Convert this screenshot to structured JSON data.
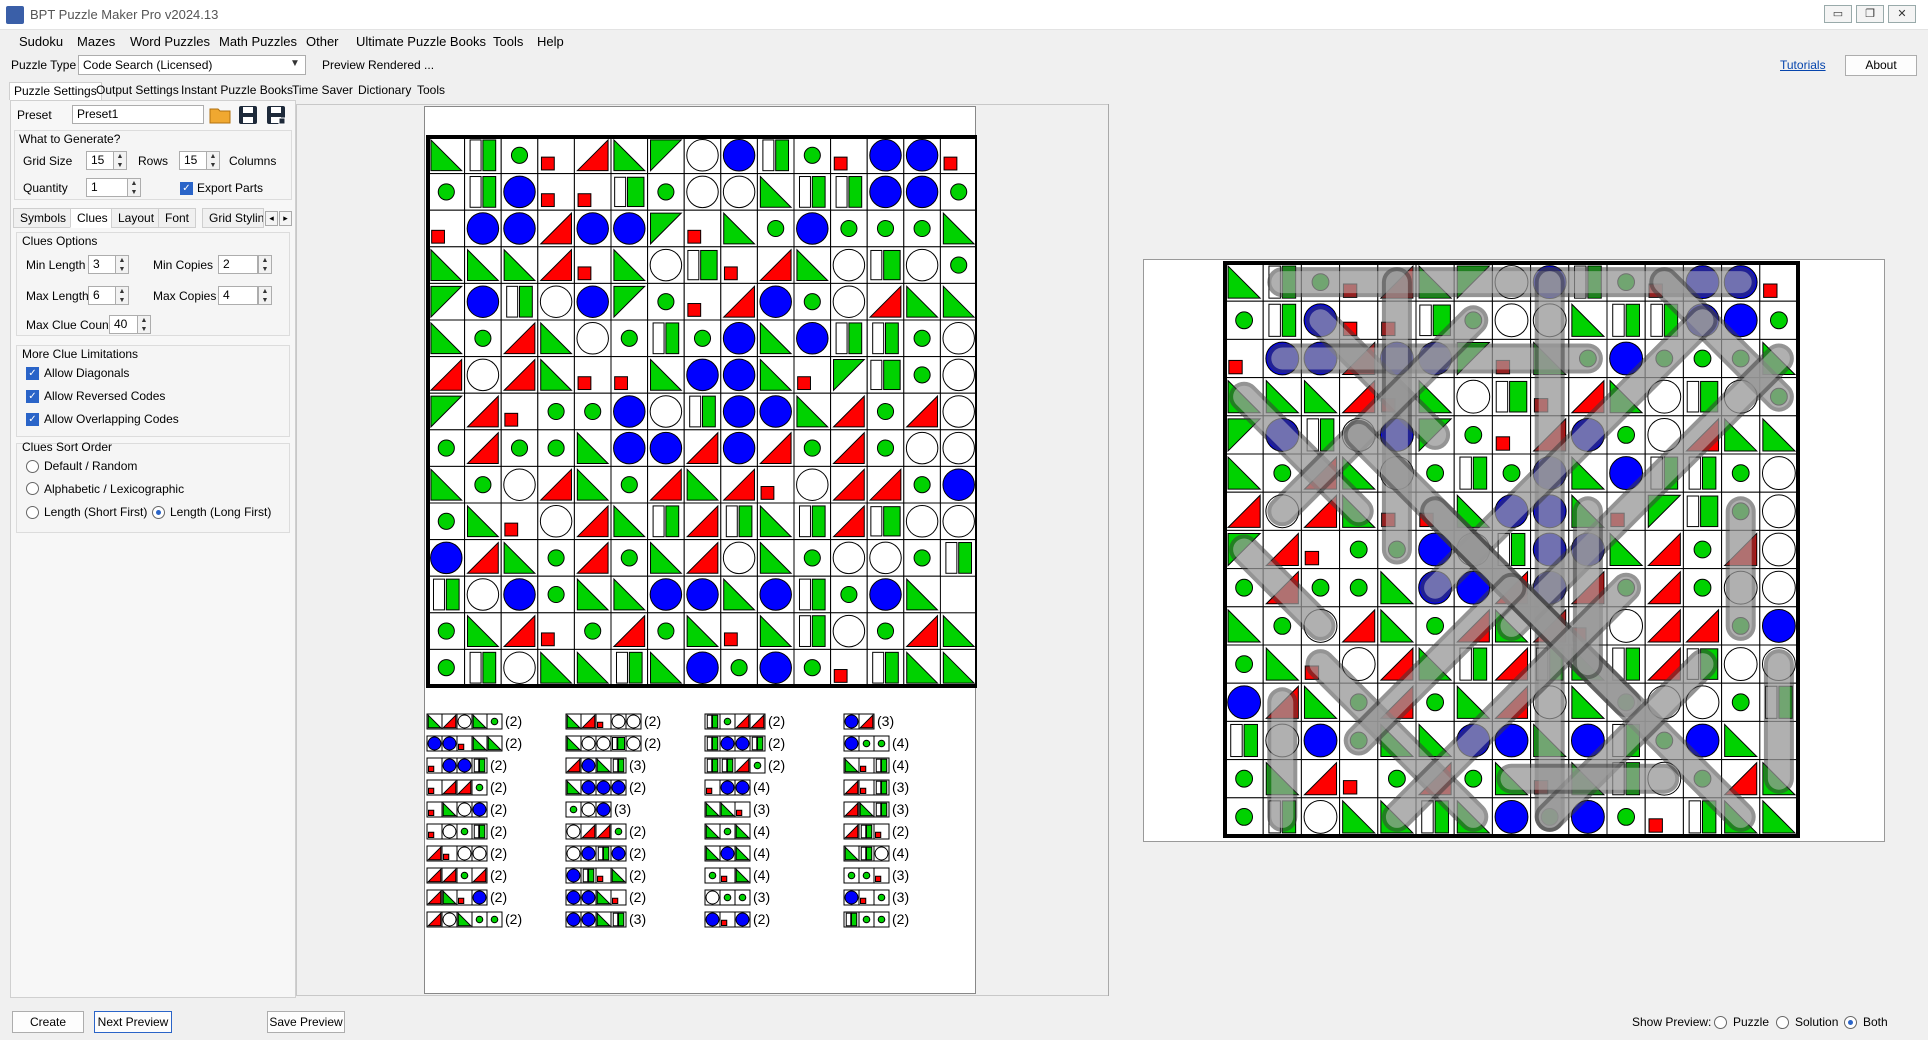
{
  "window": {
    "title": "BPT Puzzle Maker Pro v2024.13",
    "minimize": "▭",
    "restore": "❐",
    "close": "✕"
  },
  "menu": [
    "Sudoku",
    "Mazes",
    "Word Puzzles",
    "Math Puzzles",
    "Other",
    "Ultimate Puzzle Books",
    "Tools",
    "Help"
  ],
  "toprow": {
    "puzzle_type_label": "Puzzle Type",
    "puzzle_type_value": "Code Search (Licensed)",
    "preview_status": "Preview Rendered ...",
    "tutorials": "Tutorials",
    "about": "About"
  },
  "tabs": [
    "Puzzle Settings",
    "Output Settings",
    "Instant Puzzle Books",
    "Time Saver",
    "Dictionary",
    "Tools"
  ],
  "settings": {
    "preset_label": "Preset",
    "preset_value": "Preset1",
    "what_label": "What to Generate?",
    "grid_size_label": "Grid Size",
    "rows_value": "15",
    "rows_label": "Rows",
    "cols_value": "15",
    "cols_label": "Columns",
    "quantity_label": "Quantity",
    "quantity_value": "1",
    "export_parts_label": "Export Parts"
  },
  "subtabs": [
    "Symbols",
    "Clues",
    "Layout",
    "Font",
    "Grid Styling"
  ],
  "clues_options": {
    "title": "Clues Options",
    "min_length_label": "Min Length",
    "min_length": "3",
    "min_copies_label": "Min Copies",
    "min_copies": "2",
    "max_length_label": "Max Length",
    "max_length": "6",
    "max_copies_label": "Max Copies",
    "max_copies": "4",
    "max_clue_count_label": "Max Clue Count",
    "max_clue_count": "40"
  },
  "limitations": {
    "title": "More Clue Limitations",
    "items": [
      "Allow Diagonals",
      "Allow Reversed Codes",
      "Allow Overlapping Codes"
    ]
  },
  "sort_order": {
    "title": "Clues Sort Order",
    "items": [
      "Default / Random",
      "Alphabetic / Lexicographic",
      "Length (Short First)",
      "Length (Long First)"
    ]
  },
  "bottom": {
    "create": "Create",
    "next_preview": "Next Preview",
    "save_preview": "Save Preview",
    "show_preview_label": "Show Preview:",
    "options": [
      "Puzzle",
      "Solution",
      "Both"
    ]
  },
  "colors": {
    "green": "#00d200",
    "red": "#ff0000",
    "blue": "#0000ff",
    "accent": "#2a64c8"
  },
  "grid": [
    "TBdsRTVoOBdsOOs",
    "dBOsswdooTBBOOd",
    "sOOROOVsTdOdddT",
    "TTTRsTowsRTowod",
    "VOBoOVdsROdoRTT",
    "TdRTodBdOTOBBdo",
    "RoRTssTOOTsVwdo",
    "VRsddOoBOOTRdRo",
    "dRddTOORORdRdoo",
    "TdoRTdRTRsoRRdO",
    "dTsoRTBRBTBRwoo",
    "ORTdRdTRoTdoodB",
    "BoOdTTOOTOBdOT",
    "dTRsdRdTsTBodRT",
    "dBoTTBTOdOdsBTT"
  ],
  "clues": [
    [
      "TRoTd",
      "(2)",
      "TRsoo",
      "(2)",
      "BdRR",
      "(2)",
      "OR",
      "(3)"
    ],
    [
      "OOsTT",
      "(2)",
      "Toowo",
      "(2)",
      "BOOB",
      "(2)",
      "Odd",
      "(4)"
    ],
    [
      "sOOB",
      "(2)",
      "ROTB",
      "(3)",
      "BBRd",
      "(2)",
      "TsB",
      "(4)"
    ],
    [
      "sRRd",
      "(2)",
      "TOOO",
      "(2)",
      "sOO",
      "(4)",
      "RsB",
      "(3)"
    ],
    [
      "sToO",
      "(2)",
      "doO",
      "(3)",
      "TTs",
      "(3)",
      "RTB",
      "(3)"
    ],
    [
      "sodB",
      "(2)",
      "oRRd",
      "(2)",
      "TdT",
      "(4)",
      "RBs",
      "(2)"
    ],
    [
      "Rsoo",
      "(2)",
      "oOBO",
      "(2)",
      "TOT",
      "(4)",
      "TBo",
      "(4)"
    ],
    [
      "RRdR",
      "(2)",
      "OBsT",
      "(2)",
      "dsT",
      "(4)",
      "dds",
      "(3)"
    ],
    [
      "RTsO",
      "(2)",
      "OOTs",
      "(2)",
      "odd",
      "(3)",
      "Osd",
      "(3)"
    ],
    [
      "RoTdd",
      "(2)",
      "OOTB",
      "(3)",
      "OsO",
      "(2)",
      "Bdd",
      "(2)"
    ]
  ]
}
